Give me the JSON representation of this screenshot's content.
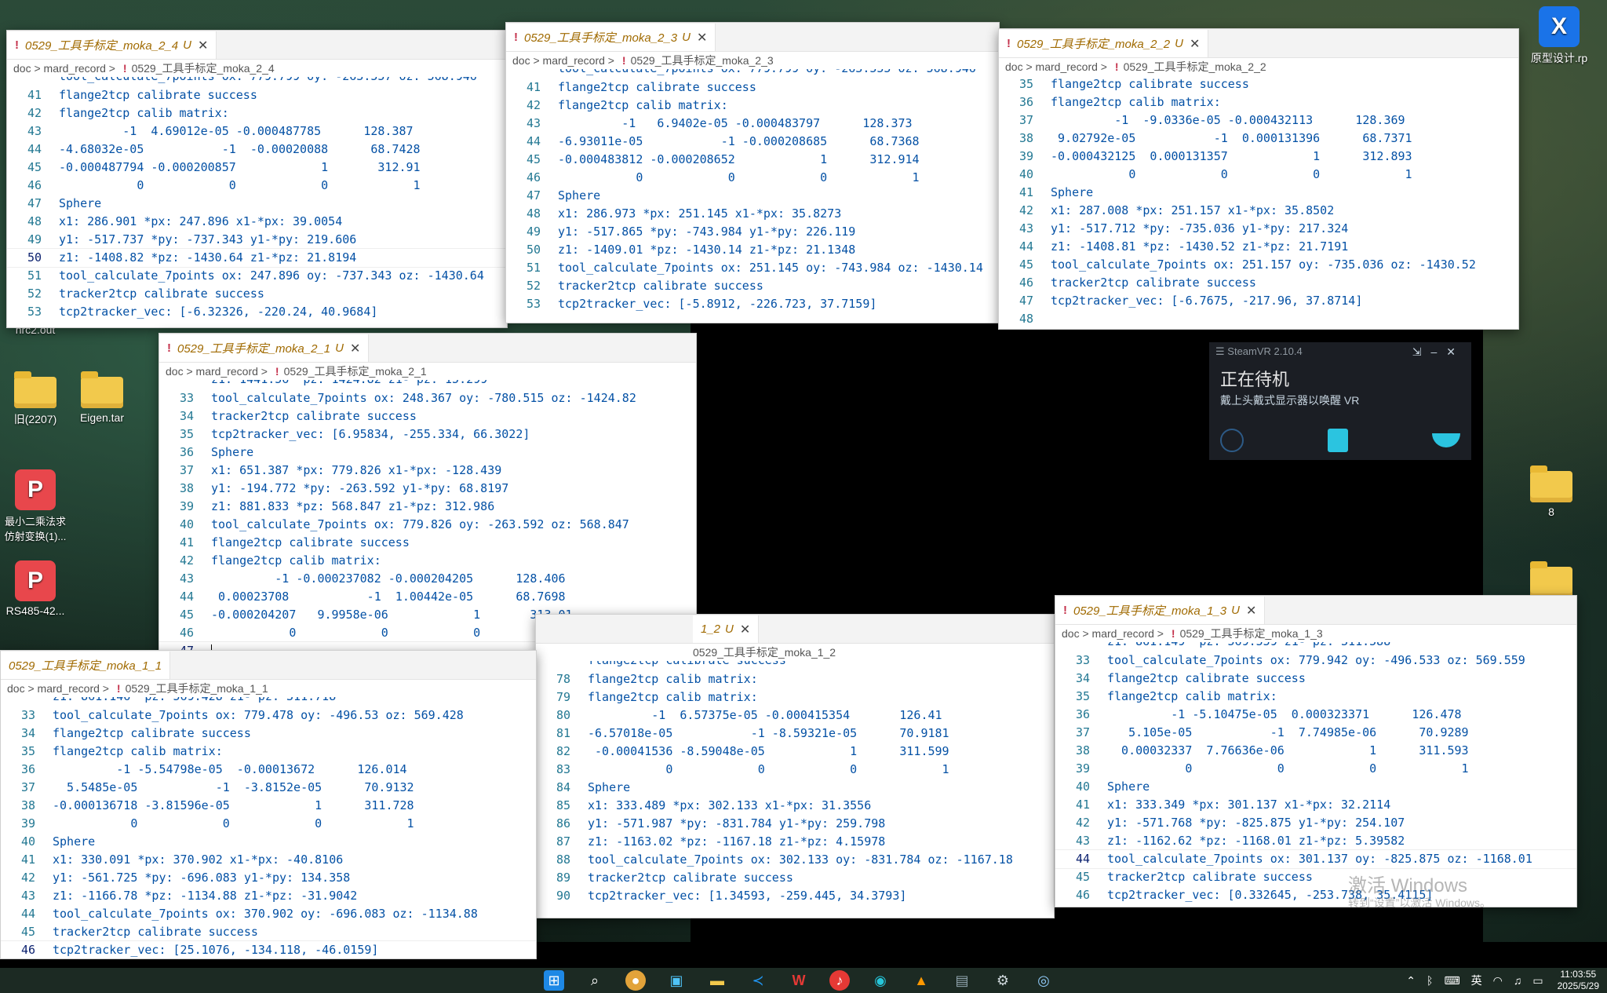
{
  "desktop": {
    "icons": [
      {
        "label": "nrc2.out"
      },
      {
        "label": "旧(2207)"
      },
      {
        "label": "Eigen.tar"
      },
      {
        "label": "最小二乘法求仿射变换(1)..."
      },
      {
        "label": "RS485-42..."
      },
      {
        "label": "原型设计.rp"
      },
      {
        "label": "8"
      }
    ]
  },
  "windows": [
    {
      "tab": "0529_工具手标定_moka_2_4",
      "breadcrumb": [
        "doc",
        "mard_record",
        "0529_工具手标定_moka_2_4"
      ],
      "partial_top": "tool_calculate_7points ox: 779.799 oy: -263.557 oz: 568.946",
      "lines": [
        {
          "n": "41",
          "t": "flange2tcp calibrate success"
        },
        {
          "n": "42",
          "t": "flange2tcp calib matrix:"
        },
        {
          "n": "43",
          "t": "         -1  4.69012e-05 -0.000487785      128.387"
        },
        {
          "n": "44",
          "t": "-4.68032e-05           -1  -0.00020088      68.7428"
        },
        {
          "n": "45",
          "t": "-0.000487794 -0.000200857            1       312.91"
        },
        {
          "n": "46",
          "t": "           0            0            0            1"
        },
        {
          "n": "47",
          "t": "Sphere"
        },
        {
          "n": "48",
          "t": "x1: 286.901 *px: 247.896 x1-*px: 39.0054"
        },
        {
          "n": "49",
          "t": "y1: -517.737 *py: -737.343 y1-*py: 219.606"
        },
        {
          "n": "50",
          "t": "z1: -1408.82 *pz: -1430.64 z1-*pz: 21.8194"
        },
        {
          "n": "51",
          "t": "tool_calculate_7points ox: 247.896 oy: -737.343 oz: -1430.64"
        },
        {
          "n": "52",
          "t": "tracker2tcp calibrate success"
        },
        {
          "n": "53",
          "t": "tcp2tracker_vec: [-6.32326, -220.24, 40.9684]"
        }
      ]
    },
    {
      "tab": "0529_工具手标定_moka_2_3",
      "breadcrumb": [
        "doc",
        "mard_record",
        "0529_工具手标定_moka_2_3"
      ],
      "partial_top": "tool_calculate_7points ox: 779.799 oy: -263.555 oz: 568.946",
      "lines": [
        {
          "n": "41",
          "t": "flange2tcp calibrate success"
        },
        {
          "n": "42",
          "t": "flange2tcp calib matrix:"
        },
        {
          "n": "43",
          "t": "         -1   6.9402e-05 -0.000483797      128.373"
        },
        {
          "n": "44",
          "t": "-6.93011e-05           -1 -0.000208685      68.7368"
        },
        {
          "n": "45",
          "t": "-0.000483812 -0.000208652            1      312.914"
        },
        {
          "n": "46",
          "t": "           0            0            0            1"
        },
        {
          "n": "47",
          "t": "Sphere"
        },
        {
          "n": "48",
          "t": "x1: 286.973 *px: 251.145 x1-*px: 35.8273"
        },
        {
          "n": "49",
          "t": "y1: -517.865 *py: -743.984 y1-*py: 226.119"
        },
        {
          "n": "50",
          "t": "z1: -1409.01 *pz: -1430.14 z1-*pz: 21.1348"
        },
        {
          "n": "51",
          "t": "tool_calculate_7points ox: 251.145 oy: -743.984 oz: -1430.14"
        },
        {
          "n": "52",
          "t": "tracker2tcp calibrate success"
        },
        {
          "n": "53",
          "t": "tcp2tracker_vec: [-5.8912, -226.723, 37.7159]"
        }
      ]
    },
    {
      "tab": "0529_工具手标定_moka_2_2",
      "breadcrumb": [
        "doc",
        "mard_record",
        "0529_工具手标定_moka_2_2"
      ],
      "partial_top": "",
      "lines": [
        {
          "n": "35",
          "t": "flange2tcp calibrate success"
        },
        {
          "n": "36",
          "t": "flange2tcp calib matrix:"
        },
        {
          "n": "37",
          "t": "         -1  -9.0336e-05 -0.000432113      128.369"
        },
        {
          "n": "38",
          "t": " 9.02792e-05           -1  0.000131396      68.7371"
        },
        {
          "n": "39",
          "t": "-0.000432125  0.000131357            1      312.893"
        },
        {
          "n": "40",
          "t": "           0            0            0            1"
        },
        {
          "n": "41",
          "t": "Sphere"
        },
        {
          "n": "42",
          "t": "x1: 287.008 *px: 251.157 x1-*px: 35.8502"
        },
        {
          "n": "43",
          "t": "y1: -517.712 *py: -735.036 y1-*py: 217.324"
        },
        {
          "n": "44",
          "t": "z1: -1408.81 *pz: -1430.52 z1-*pz: 21.7191"
        },
        {
          "n": "45",
          "t": "tool_calculate_7points ox: 251.157 oy: -735.036 oz: -1430.52"
        },
        {
          "n": "46",
          "t": "tracker2tcp calibrate success"
        },
        {
          "n": "47",
          "t": "tcp2tracker_vec: [-6.7675, -217.96, 37.8714]"
        },
        {
          "n": "48",
          "t": ""
        }
      ]
    },
    {
      "tab": "0529_工具手标定_moka_2_1",
      "breadcrumb": [
        "doc",
        "mard_record",
        "0529_工具手标定_moka_2_1"
      ],
      "partial_top": "z1: 1441.56 *pz: 1424.82 z1-*pz: 15.299",
      "lines": [
        {
          "n": "33",
          "t": "tool_calculate_7points ox: 248.367 oy: -780.515 oz: -1424.82"
        },
        {
          "n": "34",
          "t": "tracker2tcp calibrate success"
        },
        {
          "n": "35",
          "t": "tcp2tracker_vec: [6.95834, -255.334, 66.3022]"
        },
        {
          "n": "36",
          "t": "Sphere"
        },
        {
          "n": "37",
          "t": "x1: 651.387 *px: 779.826 x1-*px: -128.439"
        },
        {
          "n": "38",
          "t": "y1: -194.772 *py: -263.592 y1-*py: 68.8197"
        },
        {
          "n": "39",
          "t": "z1: 881.833 *pz: 568.847 z1-*pz: 312.986"
        },
        {
          "n": "40",
          "t": "tool_calculate_7points ox: 779.826 oy: -263.592 oz: 568.847"
        },
        {
          "n": "41",
          "t": "flange2tcp calibrate success"
        },
        {
          "n": "42",
          "t": "flange2tcp calib matrix:"
        },
        {
          "n": "43",
          "t": "         -1 -0.000237082 -0.000204205      128.406"
        },
        {
          "n": "44",
          "t": " 0.00023708           -1  1.00442e-05      68.7698"
        },
        {
          "n": "45",
          "t": "-0.000204207   9.9958e-06            1       313.01"
        },
        {
          "n": "46",
          "t": "           0            0            0            1"
        },
        {
          "n": "47",
          "t": ""
        }
      ]
    },
    {
      "tab": "0529_工具手标定_moka_1_1",
      "breadcrumb": [
        "doc",
        "mard_record",
        "0529_工具手标定_moka_1_1"
      ],
      "partial_top": "z1: 861.146 *pz: 569.428 z1-*pz: 311.718",
      "lines": [
        {
          "n": "33",
          "t": "tool_calculate_7points ox: 779.478 oy: -496.53 oz: 569.428"
        },
        {
          "n": "34",
          "t": "flange2tcp calibrate success"
        },
        {
          "n": "35",
          "t": "flange2tcp calib matrix:"
        },
        {
          "n": "36",
          "t": "         -1 -5.54798e-05  -0.00013672      126.014"
        },
        {
          "n": "37",
          "t": "  5.5485e-05           -1  -3.8152e-05      70.9132"
        },
        {
          "n": "38",
          "t": "-0.000136718 -3.81596e-05            1      311.728"
        },
        {
          "n": "39",
          "t": "           0            0            0            1"
        },
        {
          "n": "40",
          "t": "Sphere"
        },
        {
          "n": "41",
          "t": "x1: 330.091 *px: 370.902 x1-*px: -40.8106"
        },
        {
          "n": "42",
          "t": "y1: -561.725 *py: -696.083 y1-*py: 134.358"
        },
        {
          "n": "43",
          "t": "z1: -1166.78 *pz: -1134.88 z1-*pz: -31.9042"
        },
        {
          "n": "44",
          "t": "tool_calculate_7points ox: 370.902 oy: -696.083 oz: -1134.88"
        },
        {
          "n": "45",
          "t": "tracker2tcp calibrate success"
        },
        {
          "n": "46",
          "t": "tcp2tracker_vec: [25.1076, -134.118, -46.0159]"
        }
      ]
    },
    {
      "tab": "1_2",
      "breadcrumb": [
        "0529_工具手标定_moka_1_2"
      ],
      "partial_top": "flange2tcp calibrate success",
      "lines": [
        {
          "n": "78",
          "t": "flange2tcp calib matrix:"
        },
        {
          "n": "79",
          "t": "flange2tcp calib matrix:"
        },
        {
          "n": "80",
          "t": "         -1  6.57375e-05 -0.000415354       126.41"
        },
        {
          "n": "81",
          "t": "-6.57018e-05           -1 -8.59321e-05      70.9181"
        },
        {
          "n": "82",
          "t": " -0.00041536 -8.59048e-05            1      311.599"
        },
        {
          "n": "83",
          "t": "           0            0            0            1"
        },
        {
          "n": "84",
          "t": "Sphere"
        },
        {
          "n": "85",
          "t": "x1: 333.489 *px: 302.133 x1-*px: 31.3556"
        },
        {
          "n": "86",
          "t": "y1: -571.987 *py: -831.784 y1-*py: 259.798"
        },
        {
          "n": "87",
          "t": "z1: -1163.02 *pz: -1167.18 z1-*pz: 4.15978"
        },
        {
          "n": "88",
          "t": "tool_calculate_7points ox: 302.133 oy: -831.784 oz: -1167.18"
        },
        {
          "n": "89",
          "t": "tracker2tcp calibrate success"
        },
        {
          "n": "90",
          "t": "tcp2tracker_vec: [1.34593, -259.445, 34.3793]"
        }
      ]
    },
    {
      "tab": "0529_工具手标定_moka_1_3",
      "breadcrumb": [
        "doc",
        "mard_record",
        "0529_工具手标定_moka_1_3"
      ],
      "partial_top": "z1: 861.149 *pz: 569.559 z1-*pz: 311.588",
      "lines": [
        {
          "n": "33",
          "t": "tool_calculate_7points ox: 779.942 oy: -496.533 oz: 569.559"
        },
        {
          "n": "34",
          "t": "flange2tcp calibrate success"
        },
        {
          "n": "35",
          "t": "flange2tcp calib matrix:"
        },
        {
          "n": "36",
          "t": "         -1 -5.10475e-05  0.000323371      126.478"
        },
        {
          "n": "37",
          "t": "   5.105e-05           -1  7.74985e-06      70.9289"
        },
        {
          "n": "38",
          "t": "  0.00032337  7.76636e-06            1      311.593"
        },
        {
          "n": "39",
          "t": "           0            0            0            1"
        },
        {
          "n": "40",
          "t": "Sphere"
        },
        {
          "n": "41",
          "t": "x1: 333.349 *px: 301.137 x1-*px: 32.2114"
        },
        {
          "n": "42",
          "t": "y1: -571.768 *py: -825.875 y1-*py: 254.107"
        },
        {
          "n": "43",
          "t": "z1: -1162.62 *pz: -1168.01 z1-*pz: 5.39582"
        },
        {
          "n": "44",
          "t": "tool_calculate_7points ox: 301.137 oy: -825.875 oz: -1168.01"
        },
        {
          "n": "45",
          "t": "tracker2tcp calibrate success"
        },
        {
          "n": "46",
          "t": "tcp2tracker_vec: [0.332645, -253.738, 35.4115]"
        }
      ]
    }
  ],
  "steamvr": {
    "title": "SteamVR 2.10.4",
    "status": "正在待机",
    "hint": "戴上头戴式显示器以唤醒 VR"
  },
  "watermark": {
    "line1": "激活 Windows",
    "line2": "转到“设置”以激活 Windows。"
  },
  "taskbar": {
    "ime": "英",
    "time": "11:03:55",
    "date": "2025/5/29"
  }
}
